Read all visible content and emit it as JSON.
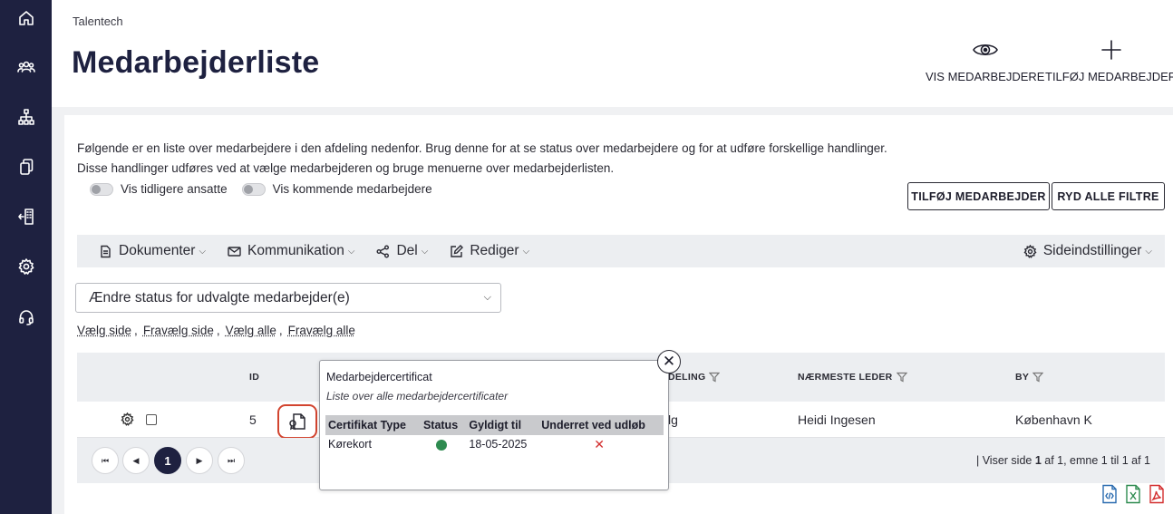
{
  "breadcrumb": "Talentech",
  "page_title": "Medarbejderliste",
  "header_actions": {
    "view_label": "VIS MEDARBEJDERE",
    "add_label": "TILFØJ MEDARBEJDER"
  },
  "sidebar": {
    "items": [
      {
        "name": "home-icon"
      },
      {
        "name": "users-icon"
      },
      {
        "name": "org-chart-icon"
      },
      {
        "name": "documents-icon"
      },
      {
        "name": "building-exit-icon"
      },
      {
        "name": "gear-icon"
      },
      {
        "name": "headset-icon"
      }
    ]
  },
  "description": {
    "line1": "Følgende er en liste over medarbejdere i den afdeling nedenfor. Brug denne for at se status over medarbejdere og for at udføre forskellige handlinger.",
    "line2": "Disse handlinger udføres ved at vælge medarbejderen og bruge menuerne over medarbejderlisten."
  },
  "toggles": {
    "previous": "Vis tidligere ansatte",
    "upcoming": "Vis kommende medarbejdere"
  },
  "buttons": {
    "add_employee": "TILFØJ MEDARBEJDER",
    "clear_filters": "RYD ALLE FILTRE"
  },
  "toolbar": {
    "documents": "Dokumenter",
    "communication": "Kommunikation",
    "share": "Del",
    "edit": "Rediger",
    "page_settings": "Sideindstillinger"
  },
  "status_select": {
    "value": "Ændre status for udvalgte medarbejder(e)"
  },
  "selection_links": {
    "select_page": "Vælg side",
    "deselect_page": "Fravælg side",
    "select_all": "Vælg alle",
    "deselect_all": "Fravælg alle"
  },
  "table": {
    "columns": {
      "id": "ID",
      "department_partial": "DELING",
      "manager": "NÆRMESTE LEDER",
      "city": "BY"
    },
    "row": {
      "id": "5",
      "department_partial": "lg",
      "manager": "Heidi Ingesen",
      "city": "København K"
    }
  },
  "pager": {
    "current_page": "1",
    "info_prefix": "| Viser side ",
    "info_page": "1",
    "info_suffix": " af 1, emne 1 til 1 af 1"
  },
  "popup": {
    "title": "Medarbejdercertificat",
    "subtitle": "Liste over alle medarbejdercertificater",
    "headers": [
      "Certifikat Type",
      "Status",
      "Gyldigt til",
      "Underret ved udløb"
    ],
    "rows": [
      {
        "type": "Kørekort",
        "status_color": "#2e8b50",
        "valid_until": "18-05-2025",
        "notify": "✕"
      }
    ],
    "close": "✕"
  },
  "colors": {
    "sidebar": "#1e2140",
    "accent_red": "#d2442f",
    "status_ok": "#2e8b50"
  }
}
